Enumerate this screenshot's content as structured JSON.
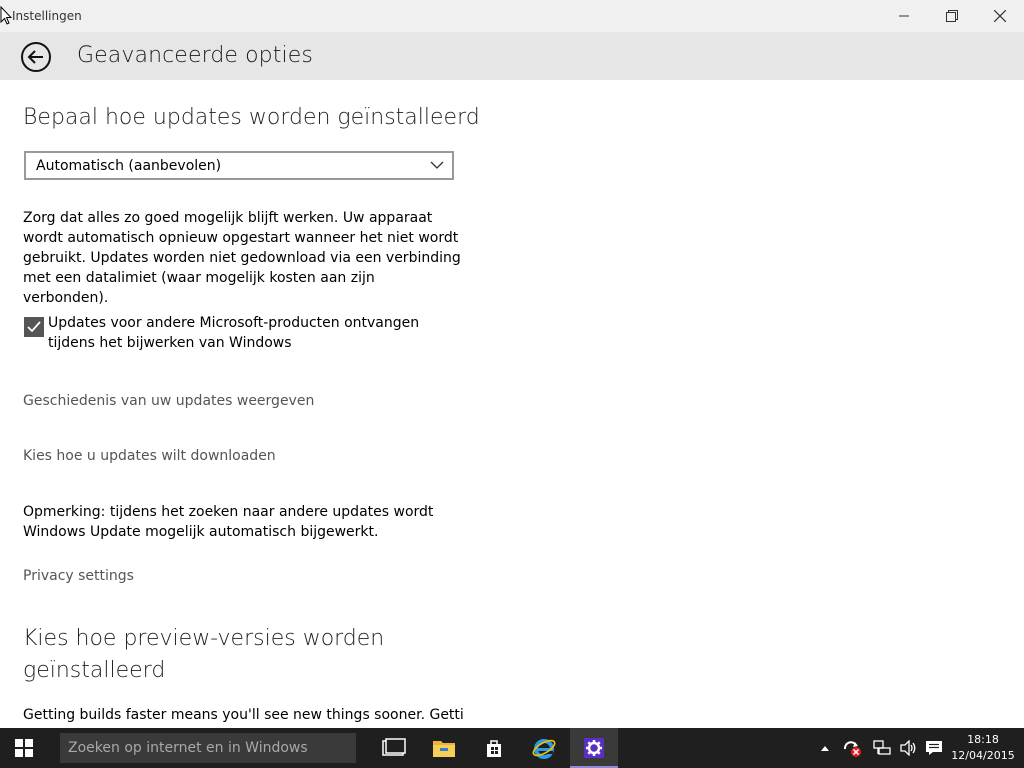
{
  "window": {
    "title": "Instellingen"
  },
  "header": {
    "title": "Geavanceerde opties"
  },
  "updates": {
    "heading": "Bepaal hoe updates worden geïnstalleerd",
    "mode_selected": "Automatisch (aanbevolen)",
    "description": "Zorg dat alles zo goed mogelijk blijft werken. Uw apparaat wordt automatisch opnieuw opgestart wanneer het niet wordt gebruikt. Updates worden niet gedownload via een verbinding met een datalimiet (waar mogelijk kosten aan zijn verbonden).",
    "other_products_label": "Updates voor andere Microsoft-producten ontvangen tijdens het bijwerken van Windows",
    "other_products_checked": true,
    "history_link": "Geschiedenis van uw updates weergeven",
    "download_link": "Kies hoe u updates wilt downloaden",
    "note": "Opmerking: tijdens het zoeken naar andere updates wordt Windows Update mogelijk automatisch bijgewerkt.",
    "privacy_link": "Privacy settings"
  },
  "preview": {
    "heading": "Kies hoe preview-versies worden geïnstalleerd",
    "description": "Getting builds faster means you'll see new things sooner. Getting"
  },
  "taskbar": {
    "search_placeholder": "Zoeken op internet en in Windows",
    "icons": [
      "windows-start-icon",
      "task-view-icon",
      "file-explorer-icon",
      "store-icon",
      "internet-explorer-icon",
      "settings-icon"
    ],
    "time": "18:18",
    "date": "12/04/2015"
  },
  "colors": {
    "accent": "#8a8ad8",
    "taskbar": "#1f1f1f",
    "header": "#e6e6e6"
  }
}
